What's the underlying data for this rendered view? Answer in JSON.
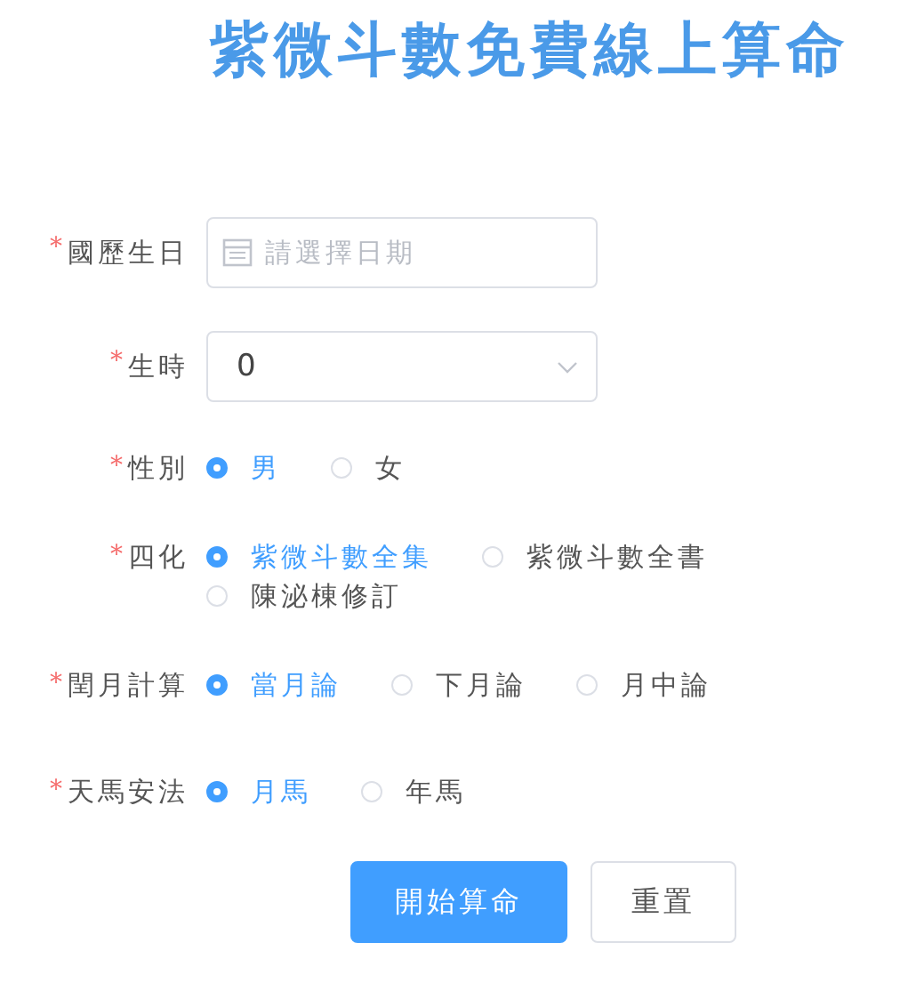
{
  "title": "紫微斗數免費線上算命",
  "fields": [
    {
      "kind": "date",
      "required_mark": "*",
      "label": "國歷生日",
      "placeholder": "請選擇日期"
    },
    {
      "kind": "select",
      "required_mark": "*",
      "label": "生時",
      "value": "0"
    },
    {
      "kind": "radio",
      "required_mark": "*",
      "label": "性別",
      "options": [
        {
          "label": "男",
          "selected": true
        },
        {
          "label": "女",
          "selected": false
        }
      ]
    },
    {
      "kind": "radio",
      "required_mark": "*",
      "label": "四化",
      "options": [
        {
          "label": "紫微斗數全集",
          "selected": true
        },
        {
          "label": "紫微斗數全書",
          "selected": false
        },
        {
          "label": "陳泌棟修訂",
          "selected": false
        }
      ]
    },
    {
      "kind": "radio",
      "required_mark": "*",
      "label": "閏月計算",
      "options": [
        {
          "label": "當月論",
          "selected": true
        },
        {
          "label": "下月論",
          "selected": false
        },
        {
          "label": "月中論",
          "selected": false
        }
      ]
    },
    {
      "kind": "radio",
      "required_mark": "*",
      "label": "天馬安法",
      "options": [
        {
          "label": "月馬",
          "selected": true
        },
        {
          "label": "年馬",
          "selected": false
        }
      ]
    }
  ],
  "buttons": [
    {
      "label": "開始算命",
      "primary": true
    },
    {
      "label": "重置",
      "primary": false
    }
  ]
}
